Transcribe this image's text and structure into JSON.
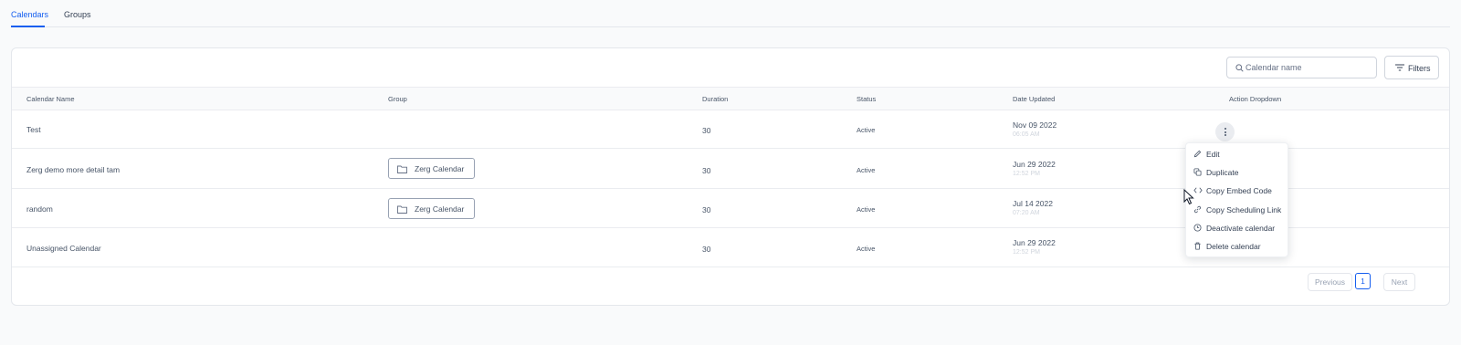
{
  "tabs": [
    {
      "label": "Calendars",
      "active": true
    },
    {
      "label": "Groups",
      "active": false
    }
  ],
  "search": {
    "placeholder": "Calendar name",
    "value": ""
  },
  "filters_label": "Filters",
  "columns": [
    "Calendar Name",
    "Group",
    "Duration",
    "Status",
    "Date Updated",
    "Action Dropdown"
  ],
  "rows": [
    {
      "name": "Test",
      "group": "",
      "duration": "30",
      "status": "Active",
      "date": "Nov 09 2022",
      "time": "06:05 AM"
    },
    {
      "name": "Zerg demo more detail tam",
      "group": "Zerg Calendar",
      "duration": "30",
      "status": "Active",
      "date": "Jun 29 2022",
      "time": "12:52 PM"
    },
    {
      "name": "random",
      "group": "Zerg Calendar",
      "duration": "30",
      "status": "Active",
      "date": "Jul 14 2022",
      "time": "07:20 AM"
    },
    {
      "name": "Unassigned Calendar",
      "group": "",
      "duration": "30",
      "status": "Active",
      "date": "Jun 29 2022",
      "time": "12:52 PM"
    }
  ],
  "action_menu": [
    {
      "label": "Edit",
      "icon": "pencil-icon"
    },
    {
      "label": "Duplicate",
      "icon": "copy-icon"
    },
    {
      "label": "Copy Embed Code",
      "icon": "code-icon"
    },
    {
      "label": "Copy Scheduling Link",
      "icon": "link-icon"
    },
    {
      "label": "Deactivate calendar",
      "icon": "clock-icon"
    },
    {
      "label": "Delete calendar",
      "icon": "trash-icon"
    }
  ],
  "pagination": {
    "previous": "Previous",
    "current_page": "1",
    "next": "Next"
  },
  "colors": {
    "accent": "#155eef",
    "border": "#e4e7ec",
    "text": "#344054",
    "muted": "#98a2b3"
  }
}
